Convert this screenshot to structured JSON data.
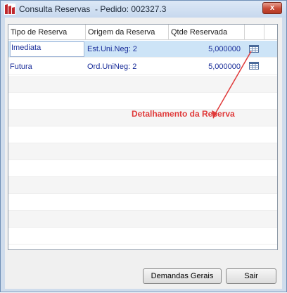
{
  "window": {
    "title": "Consulta Reservas  - Pedido: 002327.3",
    "close_label": "x"
  },
  "grid": {
    "columns": [
      "Tipo de Reserva",
      "Origem da Reserva",
      "Qtde Reservada"
    ],
    "rows": [
      {
        "tipo": "Imediata",
        "origem": "Est.Uni.Neg: 2",
        "qtde": "5,000000",
        "detail_icon": "calendar-grid-icon"
      },
      {
        "tipo": "Futura",
        "origem": "Ord.UniNeg: 2",
        "qtde": "5,000000",
        "detail_icon": "calendar-grid-icon"
      }
    ]
  },
  "annotation": {
    "text": "Detalhamento da Reserva",
    "color": "#e03a3a"
  },
  "buttons": {
    "demandas_label": "Demandas Gerais",
    "sair_label": "Sair"
  },
  "colors": {
    "selected_row": "#cde4f7",
    "cell_text": "#1a2e9a"
  }
}
